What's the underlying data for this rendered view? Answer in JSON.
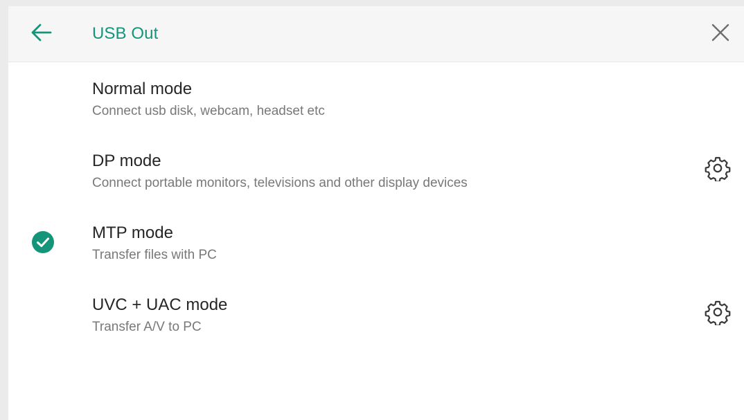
{
  "header": {
    "title": "USB Out",
    "back_icon": "arrow-left-icon",
    "close_icon": "close-icon"
  },
  "colors": {
    "accent": "#14957a",
    "title_text": "#262626",
    "subtitle_text": "#787878",
    "header_bg": "#f6f6f6"
  },
  "modes": [
    {
      "title": "Normal mode",
      "subtitle": "Connect usb disk, webcam, headset etc",
      "selected": false,
      "has_settings": false
    },
    {
      "title": "DP mode",
      "subtitle": "Connect portable monitors, televisions and other display devices",
      "selected": false,
      "has_settings": true,
      "settings_icon": "gear-icon"
    },
    {
      "title": "MTP mode",
      "subtitle": "Transfer files with PC",
      "selected": true,
      "has_settings": false,
      "selected_icon": "check-circle-icon"
    },
    {
      "title": "UVC + UAC mode",
      "subtitle": "Transfer A/V to PC",
      "selected": false,
      "has_settings": true,
      "settings_icon": "gear-icon"
    }
  ]
}
